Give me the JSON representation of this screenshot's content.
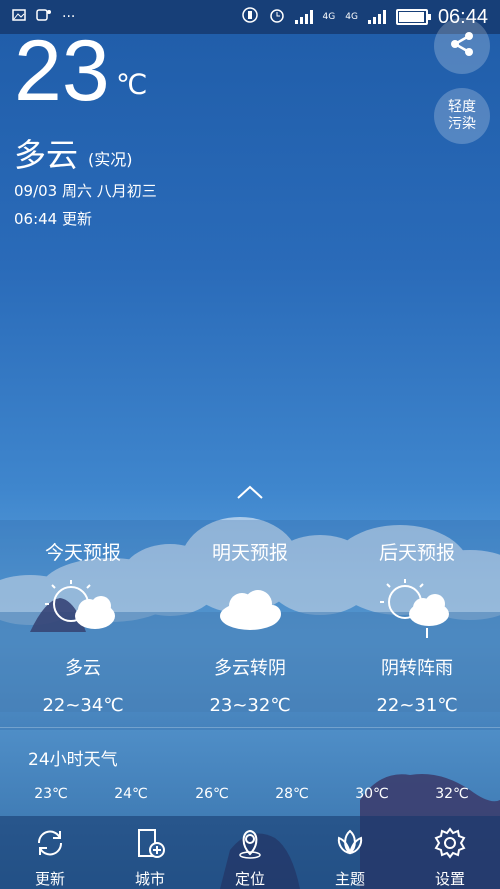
{
  "status_bar": {
    "time": "06:44",
    "network_label_1": "4G",
    "network_label_2": "4G",
    "battery_level": 0.9
  },
  "current": {
    "temperature": "23",
    "unit": "℃",
    "condition": "多云",
    "condition_note": "(实况)",
    "date_line": "09/03 周六 八月初三",
    "update_line": "06:44 更新"
  },
  "aqi_button": {
    "line1": "轻度",
    "line2": "污染"
  },
  "forecast": [
    {
      "title": "今天预报",
      "condition": "多云",
      "range": "22~34℃",
      "icon": "partly-cloudy-icon"
    },
    {
      "title": "明天预报",
      "condition": "多云转阴",
      "range": "23~32℃",
      "icon": "cloudy-icon"
    },
    {
      "title": "后天预报",
      "condition": "阴转阵雨",
      "range": "22~31℃",
      "icon": "partly-cloudy-rain-icon"
    }
  ],
  "hourly": {
    "title": "24小时天气",
    "temps": [
      "23℃",
      "24℃",
      "26℃",
      "28℃",
      "30℃",
      "32℃"
    ]
  },
  "nav": [
    {
      "label": "更新",
      "icon": "refresh-icon"
    },
    {
      "label": "城市",
      "icon": "city-add-icon"
    },
    {
      "label": "定位",
      "icon": "location-pin-icon"
    },
    {
      "label": "主题",
      "icon": "theme-lotus-icon"
    },
    {
      "label": "设置",
      "icon": "gear-icon"
    }
  ],
  "colors": {
    "status_bar": "#173f78",
    "sky_top": "#1f5ca8",
    "sky_mid": "#62a8e0"
  }
}
